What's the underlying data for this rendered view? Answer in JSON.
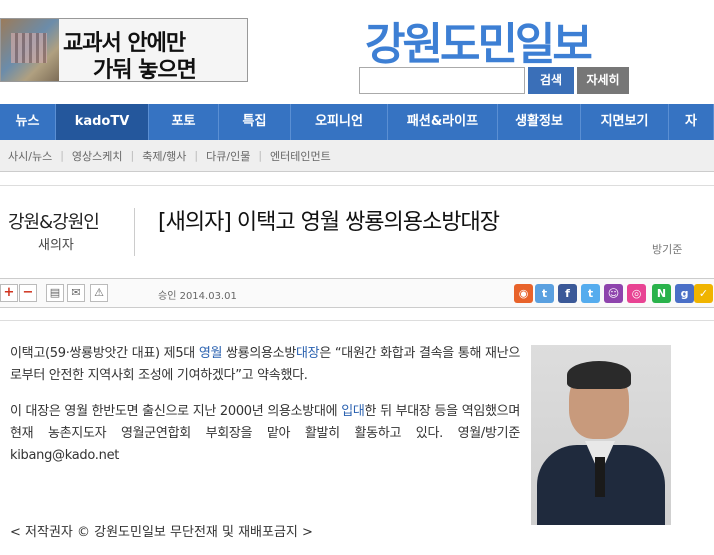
{
  "banner": {
    "line1": "교과서 안에만",
    "line2": "가둬 놓으면"
  },
  "logo": "강원도민일보",
  "search": {
    "placeholder": "",
    "button": "검색",
    "detail_button": "자세히"
  },
  "nav": [
    {
      "label": "뉴스",
      "w": 42
    },
    {
      "label": "kadoTV",
      "w": 93
    },
    {
      "label": "포토",
      "w": 72
    },
    {
      "label": "특집",
      "w": 72
    },
    {
      "label": "오피니언",
      "w": 97
    },
    {
      "label": "패션&라이프",
      "w": 110
    },
    {
      "label": "생활정보",
      "w": 83
    },
    {
      "label": "지면보기",
      "w": 90
    },
    {
      "label": "자",
      "w": 55
    }
  ],
  "subnav": [
    "사시/뉴스",
    "영상스케치",
    "축제/행사",
    "다큐/인물",
    "엔터테인먼트"
  ],
  "section": {
    "title": "강원&강원인",
    "subtitle": "새의자"
  },
  "article": {
    "title": "[새의자] 이택고 영월 쌍룡의용소방대장",
    "reporter": "방기준",
    "approved": "승인 2014.03.01",
    "para1_a": "이택고(59·쌍룡방앗간 대표) 제5대 ",
    "para1_link1": "영월",
    "para1_b": " 쌍룡의용소방",
    "para1_link2": "대장",
    "para1_c": "은 “대원간 화합과 결속을 통해 재난으로부터 안전한 지역사회 조성에 기여하겠다”고 약속했다.",
    "para2_a": "이 대장은 영월 한반도면 출신으로 지난 2000년 의용소방대에 ",
    "para2_link": "입대",
    "para2_b": "한 뒤 부대장 등을 역임했으며 현재 농촌지도자 영월군연합회 부회장을 맡아 활발히 활동하고 있다. 영월/방기준 kibang@kado.net",
    "copyright": "< 저작권자 © 강원도민일보 무단전재 및 재배포금지 >"
  },
  "toolbar": {
    "plus": "+",
    "minus": "−"
  },
  "share_colors": [
    "#e8632b",
    "#5aa0e0",
    "#3b5998",
    "#55acee",
    "#8e44ad",
    "#e84393",
    "#2ab24b",
    "#4a6fc7",
    "#f0b400"
  ],
  "share_labels": [
    "◉",
    "t",
    "f",
    "t",
    "☺",
    "◎",
    "N",
    "g",
    "✓"
  ]
}
